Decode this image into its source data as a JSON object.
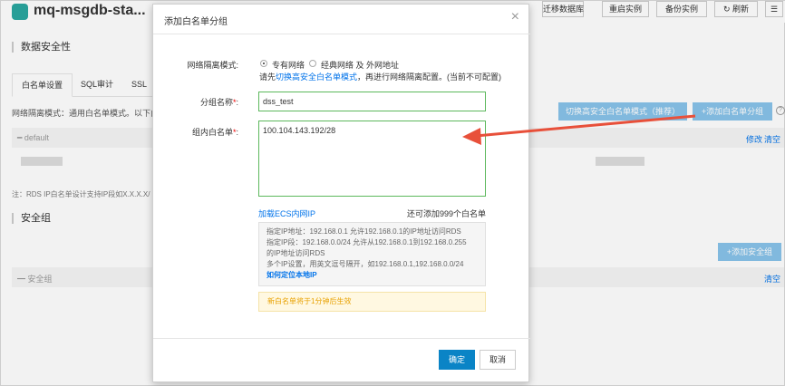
{
  "background": {
    "app_title": "mq-msgdb-sta...",
    "top_buttons": [
      "迁移数据库",
      "重启实例",
      "备份实例",
      "刷新"
    ],
    "section_title": "数据安全性",
    "tabs": [
      "白名单设置",
      "SQL审计",
      "SSL"
    ],
    "mode_text": "网络隔离模式：通用白名单模式。以下白名",
    "switch_button": "切换高安全白名单模式（推荐）",
    "add_group_button": "+添加白名单分组",
    "default_group": "default",
    "edit_link": "修改",
    "clear_link": "清空",
    "footnote": "注：RDS IP白名单设计支持IP段如X.X.X.X/",
    "security_group_title": "安全组",
    "add_security_group_button": "+添加安全组",
    "security_group_row": "安全组",
    "security_clear_link": "清空"
  },
  "modal": {
    "title": "添加白名单分组",
    "close": "×",
    "network_mode_label": "网络隔离模式:",
    "radio_vpc": "专有网络",
    "radio_classic": "经典网络 及 外网地址",
    "hint_prefix": "请先",
    "hint_link": "切换高安全白名单模式",
    "hint_suffix": "，再进行网络隔离配置。(当前不可配置)",
    "group_name_label": "分组名称",
    "group_name_value": "dss_test",
    "whitelist_label": "组内白名单",
    "whitelist_value": "100.104.143.192/28",
    "load_ecs_link": "加载ECS内网IP",
    "count_text": "还可添加999个白名单",
    "info_lines": [
      "指定IP地址：192.168.0.1 允许192.168.0.1的IP地址访问RDS",
      "指定IP段：192.168.0.0/24 允许从192.168.0.1到192.168.0.255",
      "的IP地址访问RDS",
      "多个IP设置，用英文逗号隔开，如192.168.0.1,192.168.0.0/24"
    ],
    "info_link": "如何定位本地IP",
    "warn_text": "新白名单将于1分钟后生效",
    "ok_button": "确定",
    "cancel_button": "取消"
  },
  "colors": {
    "primary": "#0a84c6",
    "link": "#0073ea",
    "light_button": "#88c3ea",
    "valid_border": "#5cb85c",
    "annotation_arrow": "#e8503a"
  }
}
